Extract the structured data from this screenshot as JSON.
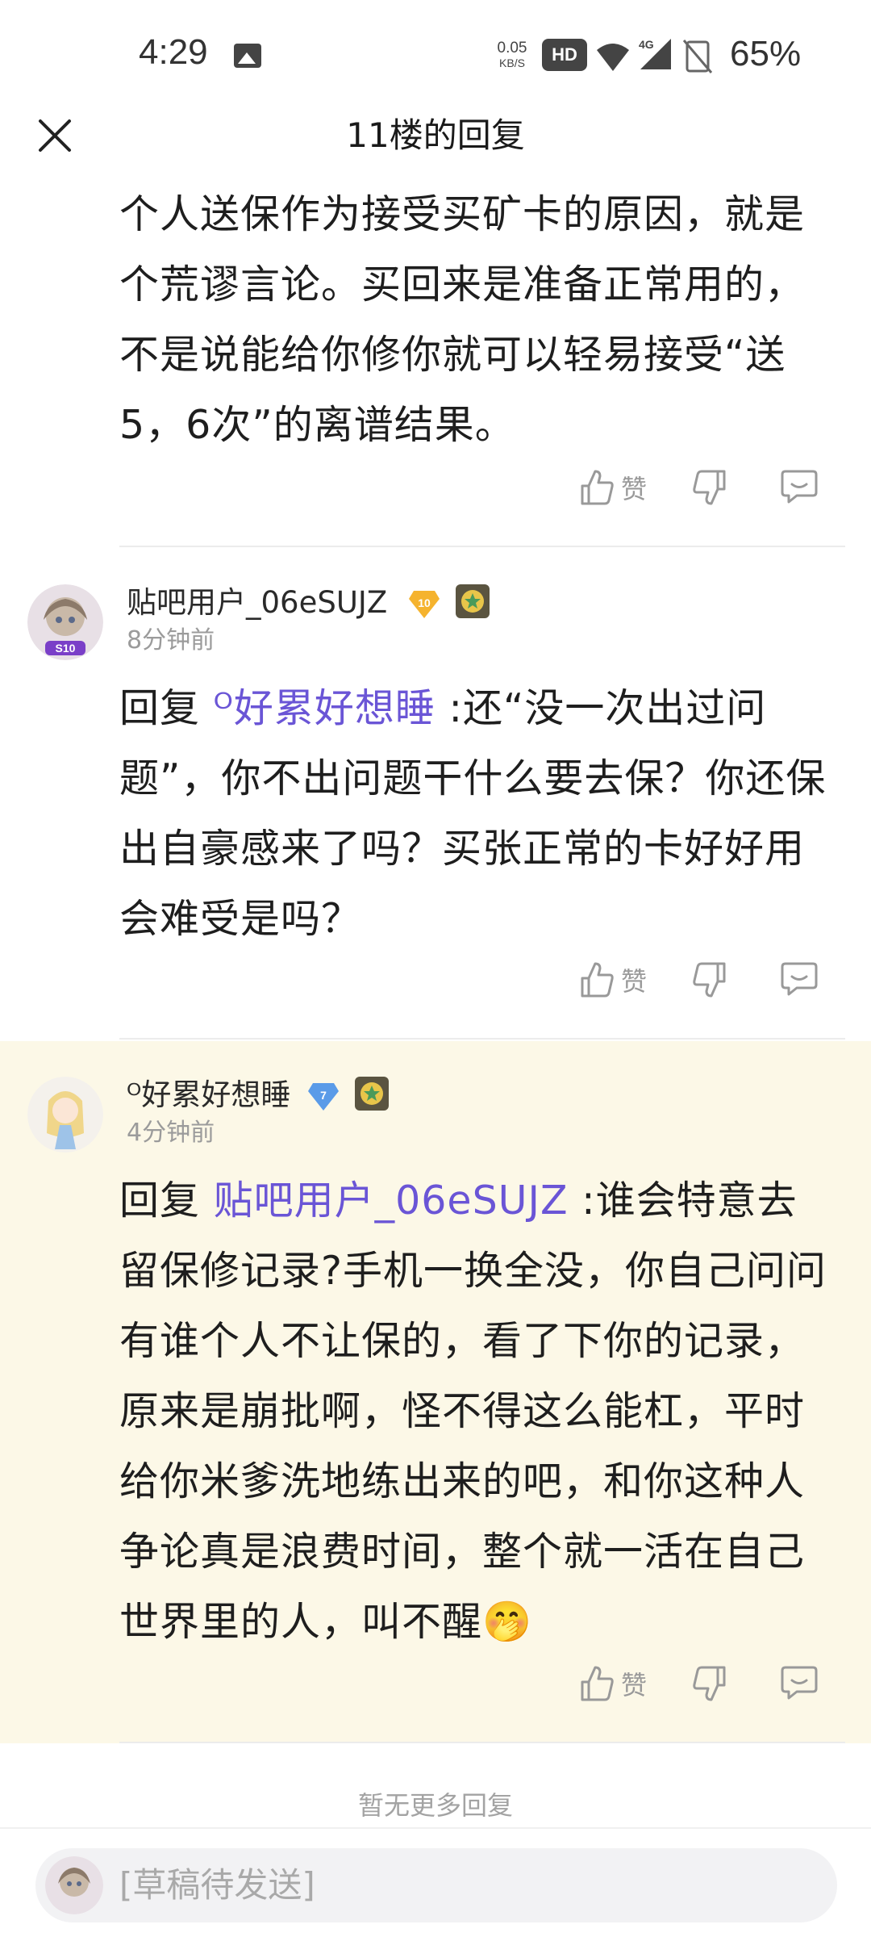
{
  "status_bar": {
    "time": "4:29",
    "net_speed_value": "0.05",
    "net_speed_unit": "KB/S",
    "hd": "HD",
    "network": "4G",
    "battery": "65%"
  },
  "header": {
    "title": "11楼的回复"
  },
  "comments": [
    {
      "text": "个人送保作为接受买矿卡的原因，就是个荒谬言论。买回来是准备正常用的，不是说能给你修你就可以轻易接受“送5，6次”的离谱结果。",
      "like_label": "赞"
    },
    {
      "username": "贴吧用户_06eSUJZ",
      "level": "10",
      "time": "8分钟前",
      "reply_prefix": "回复 ",
      "mention": "ᴼ好累好想睡",
      "text": " :还“没一次出过问题”，你不出问题干什么要去保？你还保出自豪感来了吗？买张正常的卡好好用会难受是吗？",
      "like_label": "赞"
    },
    {
      "username": "ᴼ好累好想睡",
      "level": "7",
      "time": "4分钟前",
      "reply_prefix": "回复 ",
      "mention": "贴吧用户_06eSUJZ",
      "text": " :谁会特意去留保修记录?手机一换全没，你自己问问有谁个人不让保的，看了下你的记录，原来是崩批啊，怪不得这么能杠，平时给你米爹洗地练出来的吧，和你这种人争论真是浪费时间，整个就一活在自己世界里的人，叫不醒",
      "emoji": "🤭",
      "like_label": "赞"
    }
  ],
  "footer": {
    "no_more": "暂无更多回复",
    "draft_placeholder": "[草稿待发送]"
  },
  "colors": {
    "mention": "#6a55d6",
    "highlight_bg": "#fcf8e7"
  }
}
